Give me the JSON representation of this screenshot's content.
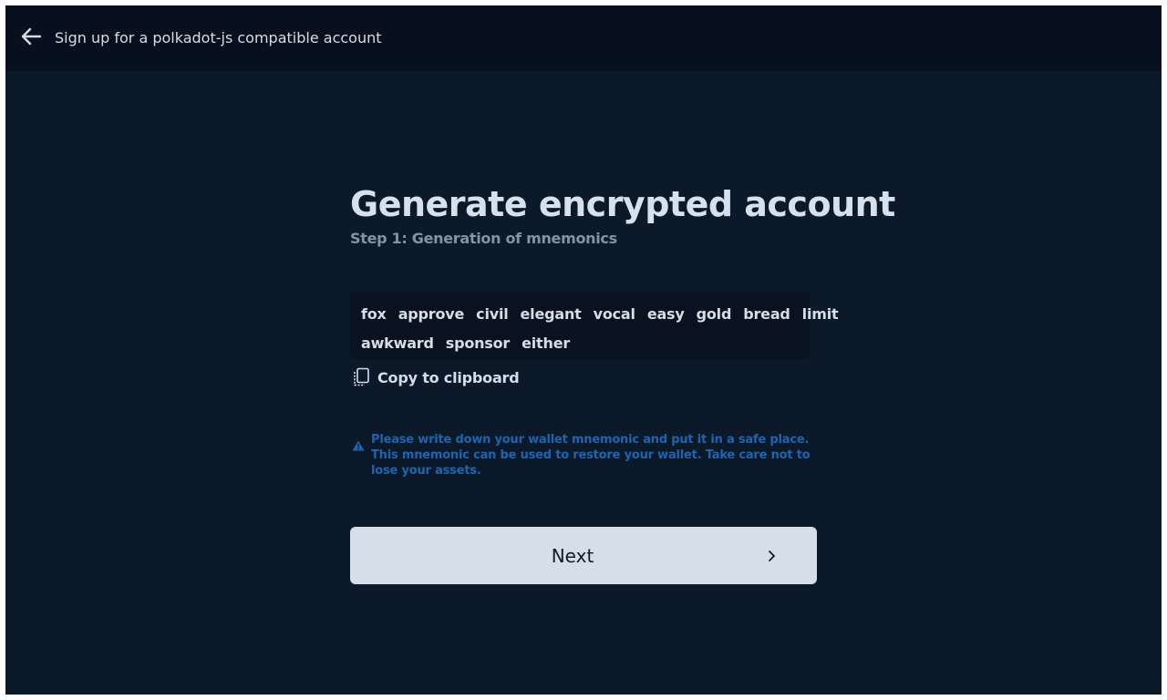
{
  "header": {
    "title": "Sign up for a polkadot-js compatible account",
    "back_icon": "arrow-left-icon"
  },
  "main": {
    "title": "Generate encrypted account",
    "subtitle": "Step 1: Generation of mnemonics",
    "mnemonic_words": [
      "fox",
      "approve",
      "civil",
      "elegant",
      "vocal",
      "easy",
      "gold",
      "bread",
      "limit",
      "awkward",
      "sponsor",
      "either"
    ],
    "copy_label": "Copy to clipboard",
    "copy_icon": "copy-icon",
    "warning_icon": "warning-triangle-icon",
    "warning_text": "Please write down your wallet mnemonic and put it in a safe place. This mnemonic can be used to restore your wallet. Take care not to lose your assets.",
    "next_label": "Next",
    "next_icon": "chevron-right-icon"
  },
  "colors": {
    "background": "#0b1929",
    "header_background": "#06111d",
    "text_primary": "#d8e0eb",
    "text_secondary": "#8494a6",
    "warning": "#1d65b0",
    "button_background": "#d5dee9"
  }
}
